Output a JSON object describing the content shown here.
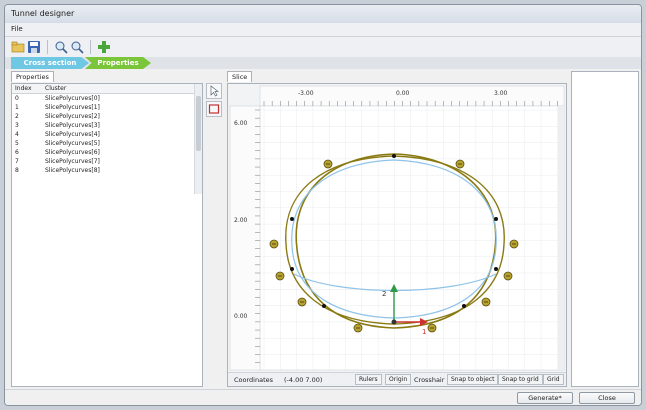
{
  "window": {
    "title": "Tunnel designer"
  },
  "menu": {
    "file": "File"
  },
  "toolbar": {
    "icons": [
      "open-folder-icon",
      "save-icon",
      "zoom-in-icon",
      "zoom-out-icon",
      "add-icon"
    ]
  },
  "breadcrumb": {
    "step1": "Cross section",
    "step2": "Properties"
  },
  "left_panel": {
    "tab": "Properties",
    "columns": [
      "Index",
      "Cluster"
    ],
    "rows": [
      [
        "0",
        "SlicePolycurves[0]"
      ],
      [
        "1",
        "SlicePolycurves[1]"
      ],
      [
        "2",
        "SlicePolycurves[2]"
      ],
      [
        "3",
        "SlicePolycurves[3]"
      ],
      [
        "4",
        "SlicePolycurves[4]"
      ],
      [
        "5",
        "SlicePolycurves[5]"
      ],
      [
        "6",
        "SlicePolycurves[6]"
      ],
      [
        "7",
        "SlicePolycurves[7]"
      ],
      [
        "8",
        "SlicePolycurves[8]"
      ]
    ]
  },
  "canvas": {
    "tab": "Slice",
    "x_ticks": [
      "-3.00",
      "0.00",
      "3.00"
    ],
    "y_ticks": [
      "6.00",
      "2.00",
      "0.00"
    ],
    "axis_labels": {
      "x": "1",
      "y": "2"
    }
  },
  "status": {
    "coords_label": "Coordinates",
    "coords_value": "(-4.00 7.00)",
    "rulers": "Rulers",
    "origin": "Origin",
    "crosshair": "Crosshair",
    "snap_object": "Snap to object",
    "snap_grid": "Snap to grid",
    "grid": "Grid"
  },
  "buttons": {
    "generate": "Generate*",
    "close": "Close"
  },
  "colors": {
    "crumb1": "#6ec7e3",
    "crumb2": "#7bc53a",
    "outer": "#8a7a12",
    "inner": "#8fc3e8",
    "accent": "#d03030"
  }
}
